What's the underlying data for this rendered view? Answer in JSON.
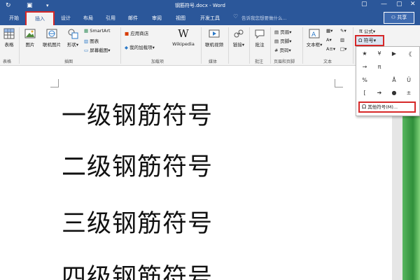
{
  "titlebar": {
    "title": "钢筋符号.docx - Word",
    "window_restore": "▢",
    "window_minimize": "—",
    "window_close": "✕"
  },
  "tabs": [
    {
      "label": "开始"
    },
    {
      "label": "插入"
    },
    {
      "label": "设计"
    },
    {
      "label": "布局"
    },
    {
      "label": "引用"
    },
    {
      "label": "邮件"
    },
    {
      "label": "审阅"
    },
    {
      "label": "视图"
    },
    {
      "label": "开发工具"
    }
  ],
  "tellme": "告诉我您想要做什么...",
  "share": "共享",
  "ribbon": {
    "table": "表格",
    "picture": "图片",
    "online_picture": "联机图片",
    "shapes": "形状",
    "smartart": "SmartArt",
    "chart": "图表",
    "screenshot": "屏幕截图",
    "store": "应用商店",
    "my_addins": "我的加载项",
    "wikipedia": "Wikipedia",
    "online_video": "联机视频",
    "link": "链接",
    "comment": "批注",
    "header": "页眉",
    "footer": "页脚",
    "page_number": "页码",
    "textbox": "文本框",
    "equation": "公式",
    "symbol": "符号",
    "groups": {
      "tables": "表格",
      "illustrations": "插图",
      "addins": "加载项",
      "media": "媒体",
      "comments": "批注",
      "header_footer": "页眉和页脚",
      "text": "文本"
    }
  },
  "document": {
    "lines": [
      "一级钢筋符号",
      "二级钢筋符号",
      "三级钢筋符号",
      "四级钢筋符号"
    ]
  },
  "symbol_menu": {
    "row1": [
      "★",
      "¥",
      "▶",
      "《"
    ],
    "row2": [
      "→",
      "π",
      "",
      ""
    ],
    "row3": [
      "%",
      "",
      "Å",
      "Ü"
    ],
    "row4": [
      "[",
      "➔",
      "●",
      "±"
    ],
    "more": "其他符号(M)..."
  }
}
